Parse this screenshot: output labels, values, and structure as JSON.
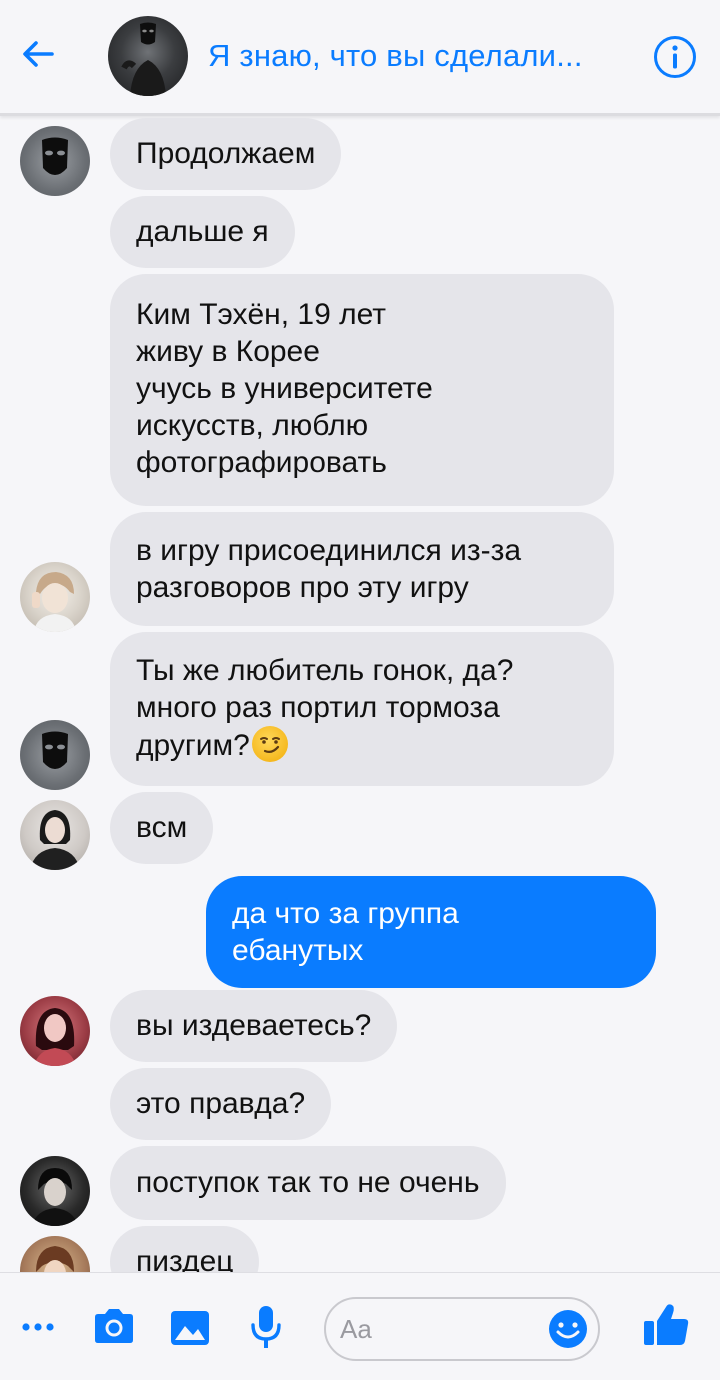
{
  "header": {
    "title": "Я знаю, что вы сделали...",
    "back_icon": "arrow-left-icon",
    "info_icon": "info-icon",
    "accent_color": "#0a7cff"
  },
  "messages": [
    {
      "sender": "mask",
      "text": "Продолжаем"
    },
    {
      "sender": "mask",
      "text": "дальше я"
    },
    {
      "sender": "taehyung",
      "lines": [
        "Ким Тэхён, 19 лет",
        "живу в Корее",
        "учусь в университете",
        "искусств, люблю",
        "фотографировать"
      ]
    },
    {
      "sender": "taehyung",
      "lines": [
        "в игру присоединился из-за",
        "разговоров про эту игру"
      ]
    },
    {
      "sender": "mask",
      "lines": [
        "Ты же любитель гонок, да?",
        "много раз портил тормоза",
        "другим?"
      ],
      "emoji": "smirk-emoji"
    },
    {
      "sender": "girl1",
      "text": "всм"
    },
    {
      "sender": "me",
      "lines": [
        "да что за группа",
        "ебанутых"
      ]
    },
    {
      "sender": "girl2",
      "text": "вы издеваетесь?"
    },
    {
      "sender": "girl2",
      "text": "это правда?"
    },
    {
      "sender": "boy2",
      "text": "поступок так то не очень"
    },
    {
      "sender": "boy3",
      "text": "пиздец"
    }
  ],
  "composer": {
    "placeholder": "Aa",
    "icons": [
      "more-icon",
      "camera-icon",
      "image-icon",
      "microphone-icon",
      "emoji-icon",
      "like-icon"
    ]
  }
}
